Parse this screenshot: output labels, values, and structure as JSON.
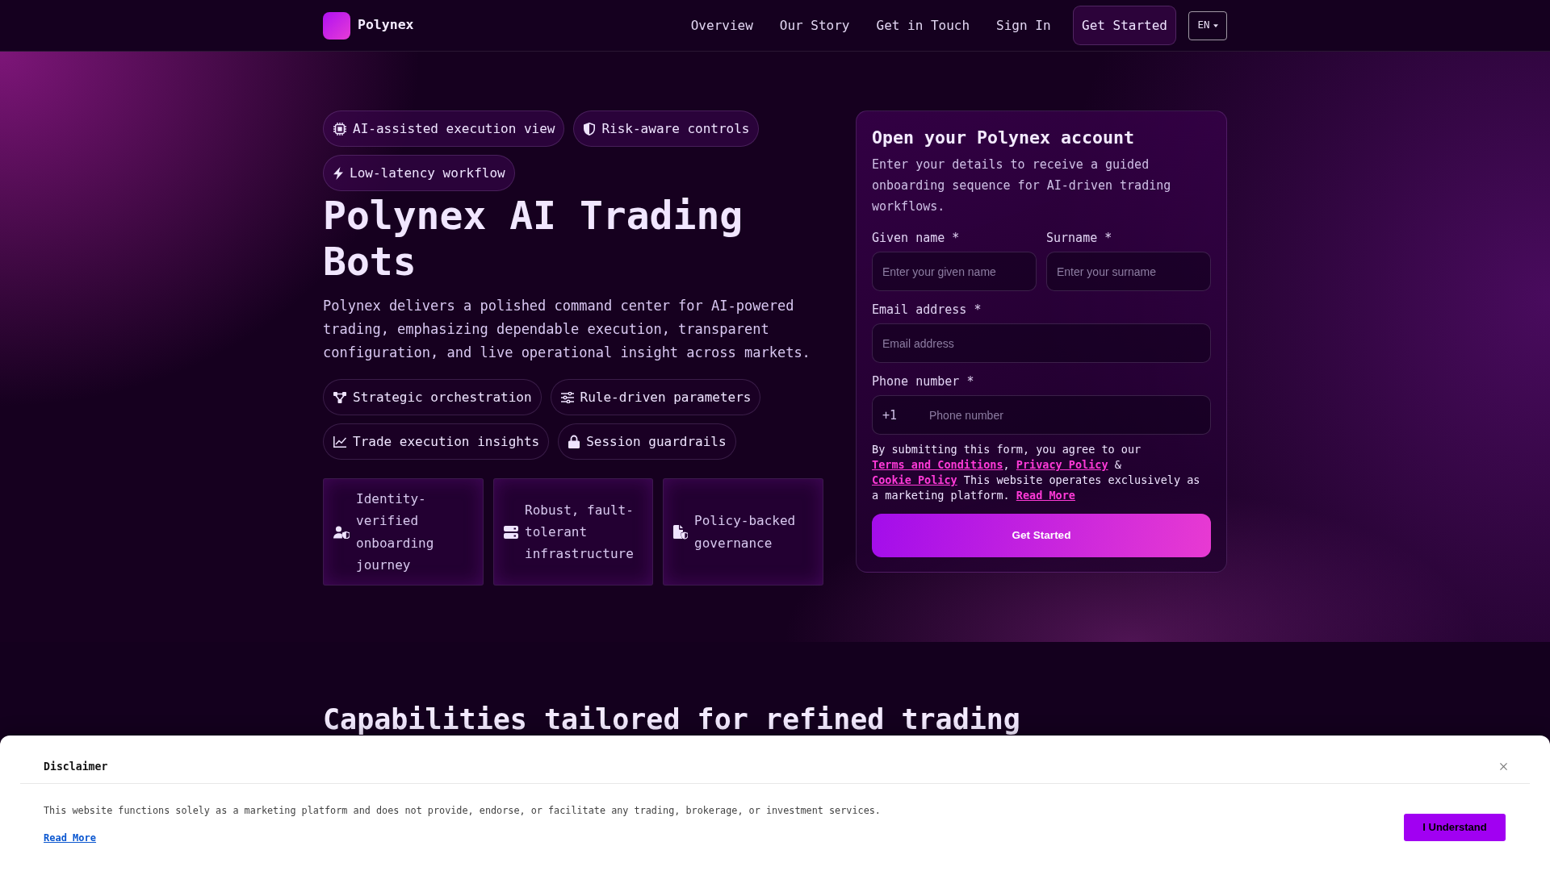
{
  "navbar": {
    "brand": "Polynex",
    "links": [
      "Overview",
      "Our Story",
      "Get in Touch",
      "Sign In"
    ],
    "cta": "Get Started",
    "language": "EN"
  },
  "hero": {
    "tags": [
      "AI-assisted execution view",
      "Risk-aware controls",
      "Low-latency workflow"
    ],
    "title": "Polynex AI Trading Bots",
    "description": "Polynex delivers a polished command center for AI-powered trading, emphasizing dependable execution, transparent configuration, and live operational insight across markets.",
    "highlights": [
      "Strategic orchestration",
      "Rule-driven parameters",
      "Trade execution insights",
      "Session guardrails"
    ],
    "features": [
      "Identity-verified onboarding journey",
      "Robust, fault-tolerant infrastructure",
      "Policy-backed governance"
    ]
  },
  "signup_form": {
    "title": "Open your Polynex account",
    "description": "Enter your details to receive a guided onboarding sequence for AI-driven trading workflows.",
    "name_fields": [
      {
        "label": "Given name *",
        "placeholder": "Enter your given name"
      },
      {
        "label": "Surname *",
        "placeholder": "Enter your surname"
      }
    ],
    "email_field": {
      "label": "Email address *",
      "placeholder": "Email address"
    },
    "phone_field": {
      "label": "Phone number *",
      "country_code": "+1",
      "placeholder": "Phone number"
    },
    "consent": [
      {
        "kind": "text",
        "text": "By submitting this form, you agree to our "
      },
      {
        "kind": "link",
        "text": "Terms and Conditions"
      },
      {
        "kind": "text",
        "text": ", "
      },
      {
        "kind": "link",
        "text": "Privacy Policy"
      },
      {
        "kind": "text",
        "text": " & "
      },
      {
        "kind": "link",
        "text": "Cookie Policy"
      },
      {
        "kind": "text",
        "text": " This website operates exclusively as a marketing platform. "
      },
      {
        "kind": "link",
        "text": "Read More"
      }
    ],
    "submit": "Get Started"
  },
  "capabilities": {
    "title": "Capabilities tailored for refined trading"
  },
  "disclaimer": {
    "title": "Disclaimer",
    "text": "This website functions solely as a marketing platform and does not provide, endorse, or facilitate any trading, brokerage, or investment services.",
    "link": "Read More",
    "button": "I Understand"
  }
}
